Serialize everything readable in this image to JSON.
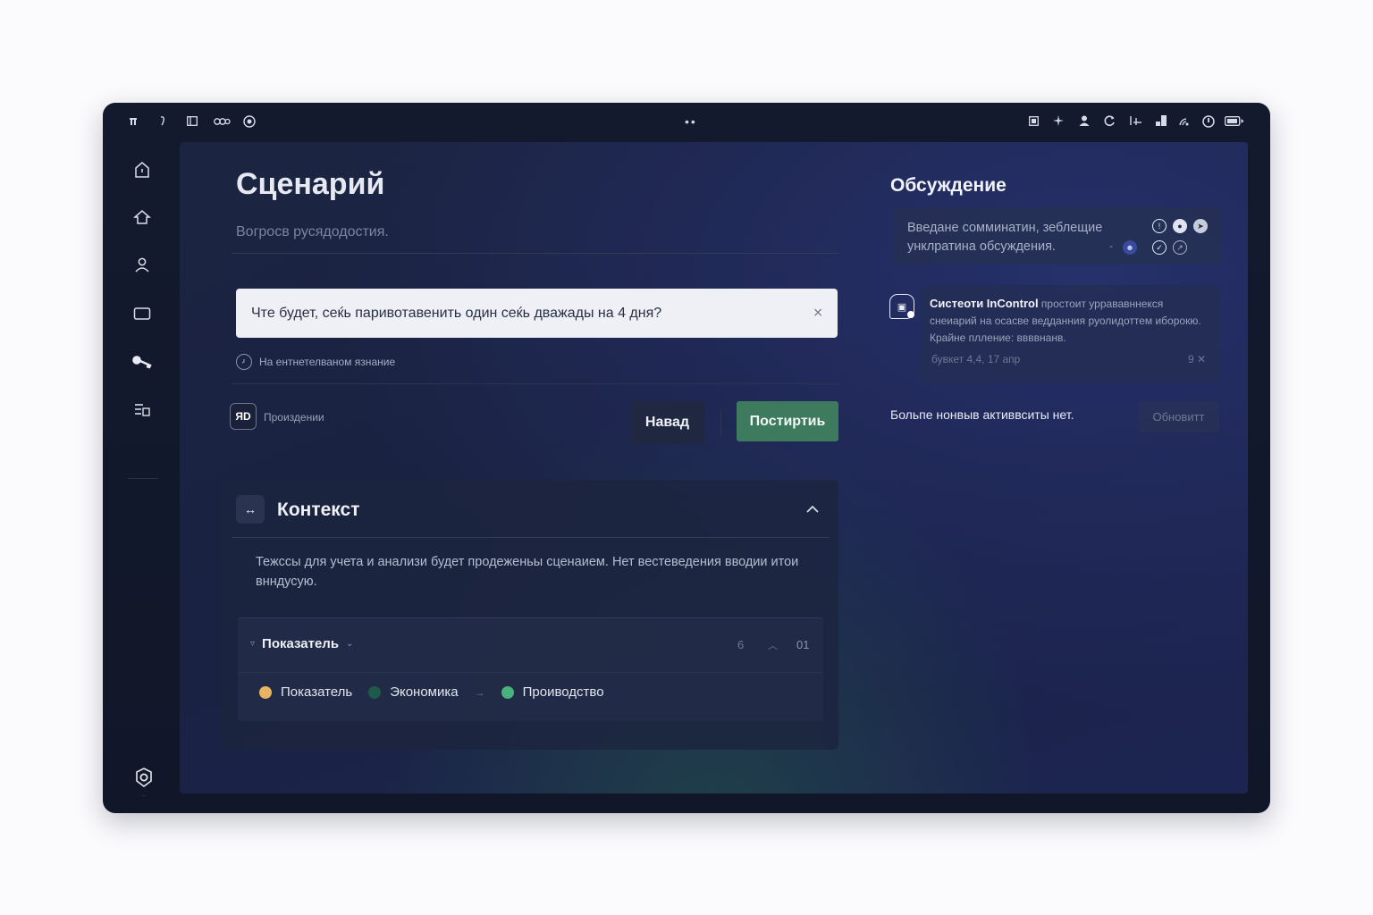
{
  "topbar": {
    "left_icons": [
      "tower-icon",
      "pin-icon",
      "panel-icon",
      "link-icon",
      "record-icon"
    ],
    "right_icons": [
      "grid-icon",
      "sparkle-icon",
      "user-icon",
      "refresh-icon",
      "sliders-icon",
      "bars-icon",
      "signal-icon",
      "power-icon",
      "battery-icon"
    ]
  },
  "sidebar": {
    "items": [
      "home-outline-icon",
      "house-icon",
      "person-icon",
      "window-icon",
      "key-icon",
      "list-edit-icon"
    ],
    "bottom_icon": "settings-shield-icon"
  },
  "main": {
    "title": "Сценарий",
    "subtitle": "Вогросв русядодостия.",
    "query": {
      "value": "Чте будет, сеќь паривотавенить один сеќь дважады на 4 дня?",
      "clear_glyph": "⨯"
    },
    "hint": "На ентнетелваном язнание",
    "attachment_label": "Произдении",
    "attachment_glyph": "ЯD",
    "back_label": "Навад",
    "build_label": "Постиртиь"
  },
  "context": {
    "icon_glyph": "↔",
    "title": "Контекст",
    "description": "Тежссы для учета и анализи будет продеженьы сценаием. Нет вестеведения вводии итои внндусую.",
    "metric": {
      "label": "Показатель",
      "count": "6",
      "index": "01",
      "flow": [
        {
          "label": "Показатель",
          "color": "#e7b462"
        },
        {
          "label": "Экономика",
          "color": "#1f5a48"
        },
        {
          "label": "Проиводство",
          "color": "#4ab07d"
        }
      ]
    }
  },
  "discussion": {
    "title": "Обсуждение",
    "composer_placeholder": "Введане сомминатин, зеблещие унклратина обсуждения.",
    "notice": {
      "sender": "Систеоти InControl",
      "body": " простоит уррававннекся снеиарий на осасве ведданния руолидоттем иборокю. Крайне пллениe: ввввнанв.",
      "meta": "бувкет 4,4, 17 апр",
      "dismiss": "9 ✕"
    },
    "empty_text": "Больпе нонвыв активвситы нет.",
    "refresh_label": "Обновитт"
  },
  "colors": {
    "accent_green": "#3d7a5e",
    "window_bg": "#141a2e",
    "panel_bg": "#1b2440"
  }
}
